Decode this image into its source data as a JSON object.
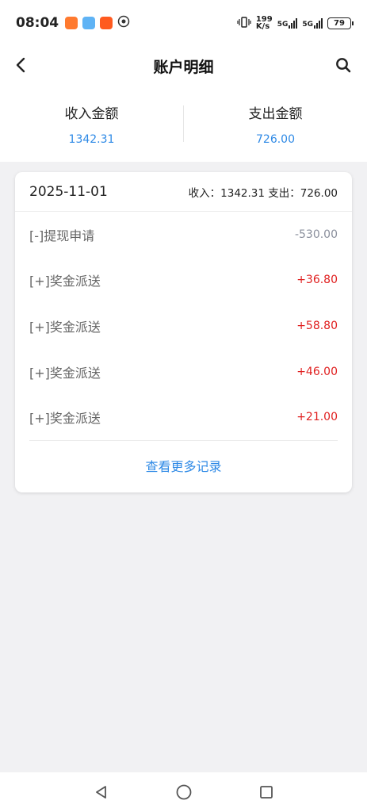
{
  "status_bar": {
    "time": "08:04",
    "net_speed_top": "199",
    "net_speed_bottom": "K/s",
    "sig1": "5G",
    "sig2": "5G",
    "battery": "79"
  },
  "nav": {
    "title": "账户明细"
  },
  "summary": {
    "income_label": "收入金额",
    "income_value": "1342.31",
    "expense_label": "支出金额",
    "expense_value": "726.00"
  },
  "card": {
    "date": "2025-11-01",
    "totals": "收入：1342.31 支出：726.00",
    "rows": [
      {
        "label": "[-]提现申请",
        "amount": "-530.00"
      },
      {
        "label": "[+]奖金派送",
        "amount": "+36.80"
      },
      {
        "label": "[+]奖金派送",
        "amount": "+58.80"
      },
      {
        "label": "[+]奖金派送",
        "amount": "+46.00"
      },
      {
        "label": "[+]奖金派送",
        "amount": "+21.00"
      }
    ],
    "more_label": "查看更多记录"
  },
  "colors": {
    "accent": "#2f8ae6",
    "positive": "#e02020",
    "negative": "#8a8f9c",
    "background": "#f1f1f3"
  }
}
